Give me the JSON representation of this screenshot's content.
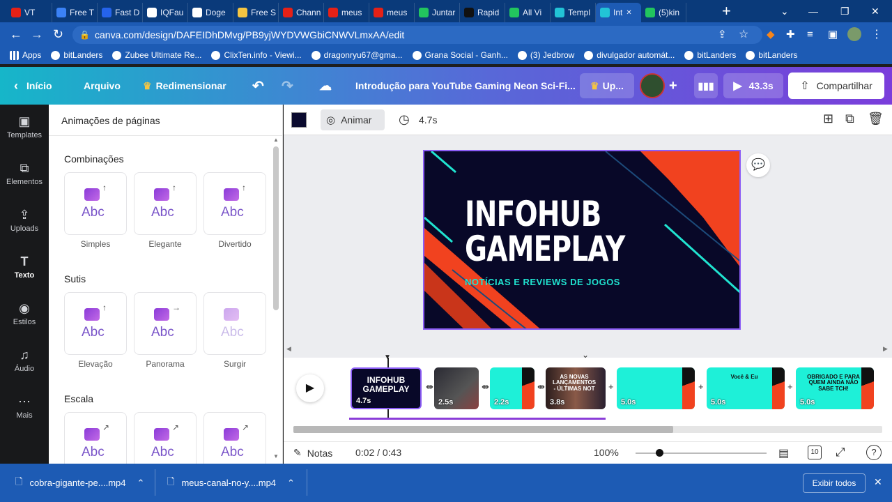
{
  "browser": {
    "tabs": [
      {
        "label": "VT",
        "color": "#e62117"
      },
      {
        "label": "Free T",
        "color": "#3b82f6"
      },
      {
        "label": "Fast D",
        "color": "#2563eb"
      },
      {
        "label": "IQFau",
        "color": "#ffffff"
      },
      {
        "label": "Doge",
        "color": "#ffffff"
      },
      {
        "label": "Free S",
        "color": "#f5c542"
      },
      {
        "label": "Chann",
        "color": "#e62117"
      },
      {
        "label": "meus",
        "color": "#e62117"
      },
      {
        "label": "meus",
        "color": "#e62117"
      },
      {
        "label": "Juntar",
        "color": "#22c55e"
      },
      {
        "label": "Rapid",
        "color": "#111111"
      },
      {
        "label": "All Vi",
        "color": "#22c55e"
      },
      {
        "label": "Templ",
        "color": "#22c3d6"
      },
      {
        "label": "Int",
        "color": "#22c3d6",
        "active": true
      },
      {
        "label": "(5)kin",
        "color": "#22c55e"
      }
    ],
    "new_tab": "+",
    "url": "canva.com/design/DAFEIDhDMvg/PB9yjWYDVWGbiCNWVLmxAA/edit",
    "bookmarks": [
      "Apps",
      "bitLanders",
      "Zubee Ultimate Re...",
      "ClixTen.info - Viewi...",
      "dragonryu67@gma...",
      "Grana Social - Ganh...",
      "(3) Jedbrow",
      "divulgador automát...",
      "bitLanders",
      "bitLanders"
    ]
  },
  "canva": {
    "home": "Início",
    "file": "Arquivo",
    "resize": "Redimensionar",
    "title": "Introdução para YouTube Gaming Neon Sci-Fi...",
    "upgrade": "Up...",
    "play_duration": "43.3s",
    "share": "Compartilhar",
    "sidebar": [
      "Templates",
      "Elementos",
      "Uploads",
      "Texto",
      "Estilos",
      "Áudio",
      "Mais"
    ],
    "panel": {
      "title": "Animações de páginas",
      "sections": [
        {
          "name": "Combinações",
          "items": [
            "Simples",
            "Elegante",
            "Divertido"
          ]
        },
        {
          "name": "Sutis",
          "items": [
            "Elevação",
            "Panorama",
            "Surgir"
          ]
        },
        {
          "name": "Escala",
          "items": [
            "",
            "",
            ""
          ]
        }
      ],
      "abc": "Abc"
    },
    "toolbar": {
      "color": "#0a0a2e",
      "animate": "Animar",
      "duration": "4.7s"
    },
    "slide": {
      "line1": "INFOHUB",
      "line2": "GAMEPLAY",
      "subtitle": "NOTÍCIAS E REVIEWS DE JOGOS"
    },
    "timeline": {
      "clips": [
        {
          "duration": "4.7s",
          "kind": "title",
          "text": "INFOHUB GAMEPLAY"
        },
        {
          "duration": "2.5s",
          "kind": "dark"
        },
        {
          "duration": "2.2s",
          "kind": "cyan"
        },
        {
          "duration": "3.8s",
          "kind": "photo",
          "text": "AS NOVAS LANÇAMENTOS - ÚLTIMAS NOT"
        },
        {
          "duration": "5.0s",
          "kind": "cyan"
        },
        {
          "duration": "5.0s",
          "kind": "cyanwide",
          "text": "Você & Eu"
        },
        {
          "duration": "5.0s",
          "kind": "cyanwide",
          "text": "OBRIGADO E PARA QUEM AINDA NÃO SABE TCH!"
        }
      ]
    },
    "bottom": {
      "notes": "Notas",
      "time": "0:02 / 0:43",
      "zoom": "100%",
      "page_count": "10",
      "help": "?"
    }
  },
  "downloads": {
    "files": [
      "cobra-gigante-pe....mp4",
      "meus-canal-no-y....mp4"
    ],
    "show_all": "Exibir todos"
  }
}
